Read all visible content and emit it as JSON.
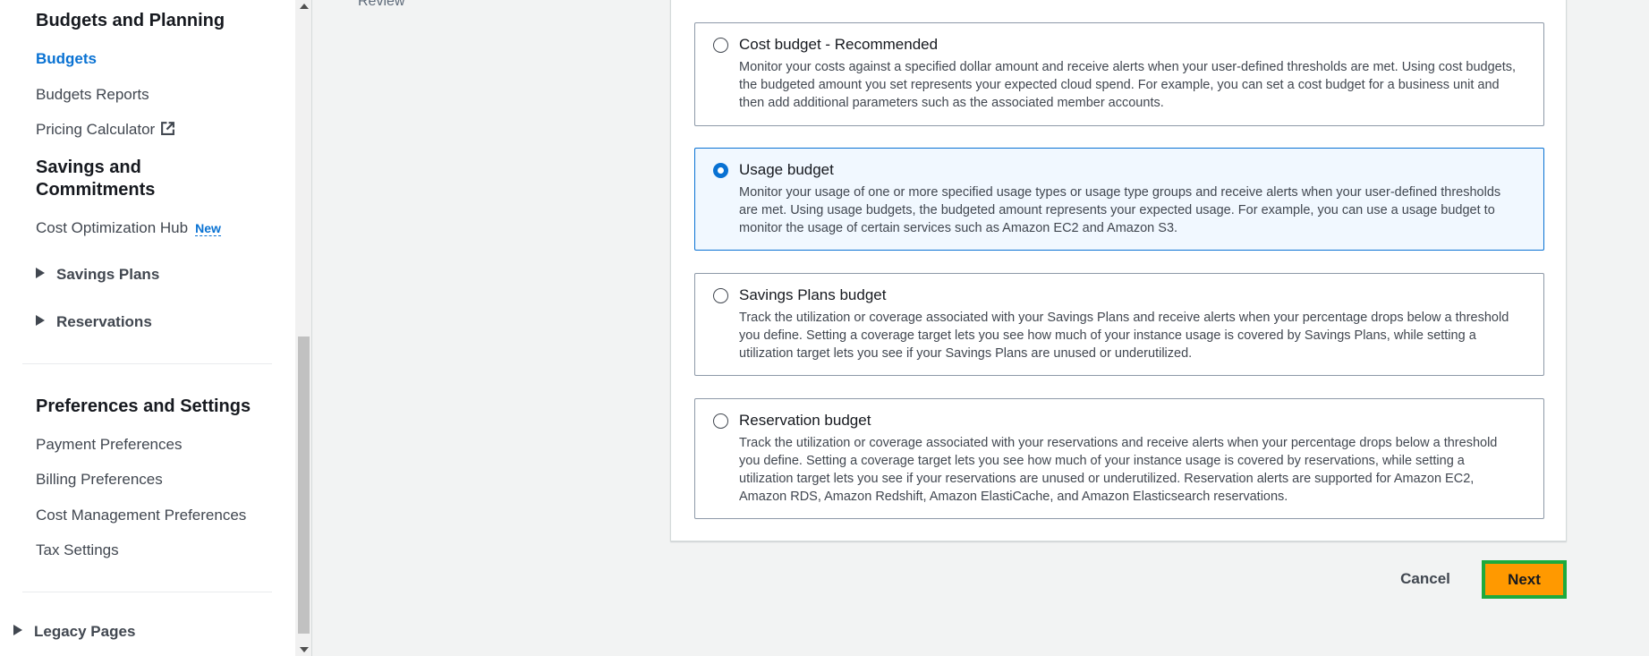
{
  "sidebar": {
    "budgets_section_title": "Budgets and Planning",
    "budgets_link": "Budgets",
    "budgets_reports_link": "Budgets Reports",
    "pricing_calculator_link": "Pricing Calculator",
    "savings_section_title_line1": "Savings and",
    "savings_section_title_line2": "Commitments",
    "cost_optimization_hub_link": "Cost Optimization Hub",
    "new_badge": "New",
    "savings_plans_expander": "Savings Plans",
    "reservations_expander": "Reservations",
    "preferences_section_title": "Preferences and Settings",
    "payment_preferences_link": "Payment Preferences",
    "billing_preferences_link": "Billing Preferences",
    "cost_management_preferences_link": "Cost Management Preferences",
    "tax_settings_link": "Tax Settings",
    "legacy_pages_expander": "Legacy Pages"
  },
  "main": {
    "review_step_label": "Review",
    "budget_types": [
      {
        "title": "Cost budget - Recommended",
        "description": "Monitor your costs against a specified dollar amount and receive alerts when your user-defined thresholds are met. Using cost budgets, the budgeted amount you set represents your expected cloud spend. For example, you can set a cost budget for a business unit and then add additional parameters such as the associated member accounts.",
        "selected": false
      },
      {
        "title": "Usage budget",
        "description": "Monitor your usage of one or more specified usage types or usage type groups and receive alerts when your user-defined thresholds are met. Using usage budgets, the budgeted amount represents your expected usage. For example, you can use a usage budget to monitor the usage of certain services such as Amazon EC2 and Amazon S3.",
        "selected": true
      },
      {
        "title": "Savings Plans budget",
        "description": "Track the utilization or coverage associated with your Savings Plans and receive alerts when your percentage drops below a threshold you define. Setting a coverage target lets you see how much of your instance usage is covered by Savings Plans, while setting a utilization target lets you see if your Savings Plans are unused or underutilized.",
        "selected": false
      },
      {
        "title": "Reservation budget",
        "description": "Track the utilization or coverage associated with your reservations and receive alerts when your percentage drops below a threshold you define. Setting a coverage target lets you see how much of your instance usage is covered by reservations, while setting a utilization target lets you see if your reservations are unused or underutilized. Reservation alerts are supported for Amazon EC2, Amazon RDS, Amazon Redshift, Amazon ElastiCache, and Amazon Elasticsearch reservations.",
        "selected": false
      }
    ],
    "cancel_label": "Cancel",
    "next_label": "Next"
  },
  "colors": {
    "accent": "#0972d3",
    "primary_button": "#ff9900",
    "focus_outline": "#1daa3c"
  },
  "icons": {
    "external_link": "external-link-icon",
    "caret": "caret-right-icon"
  }
}
